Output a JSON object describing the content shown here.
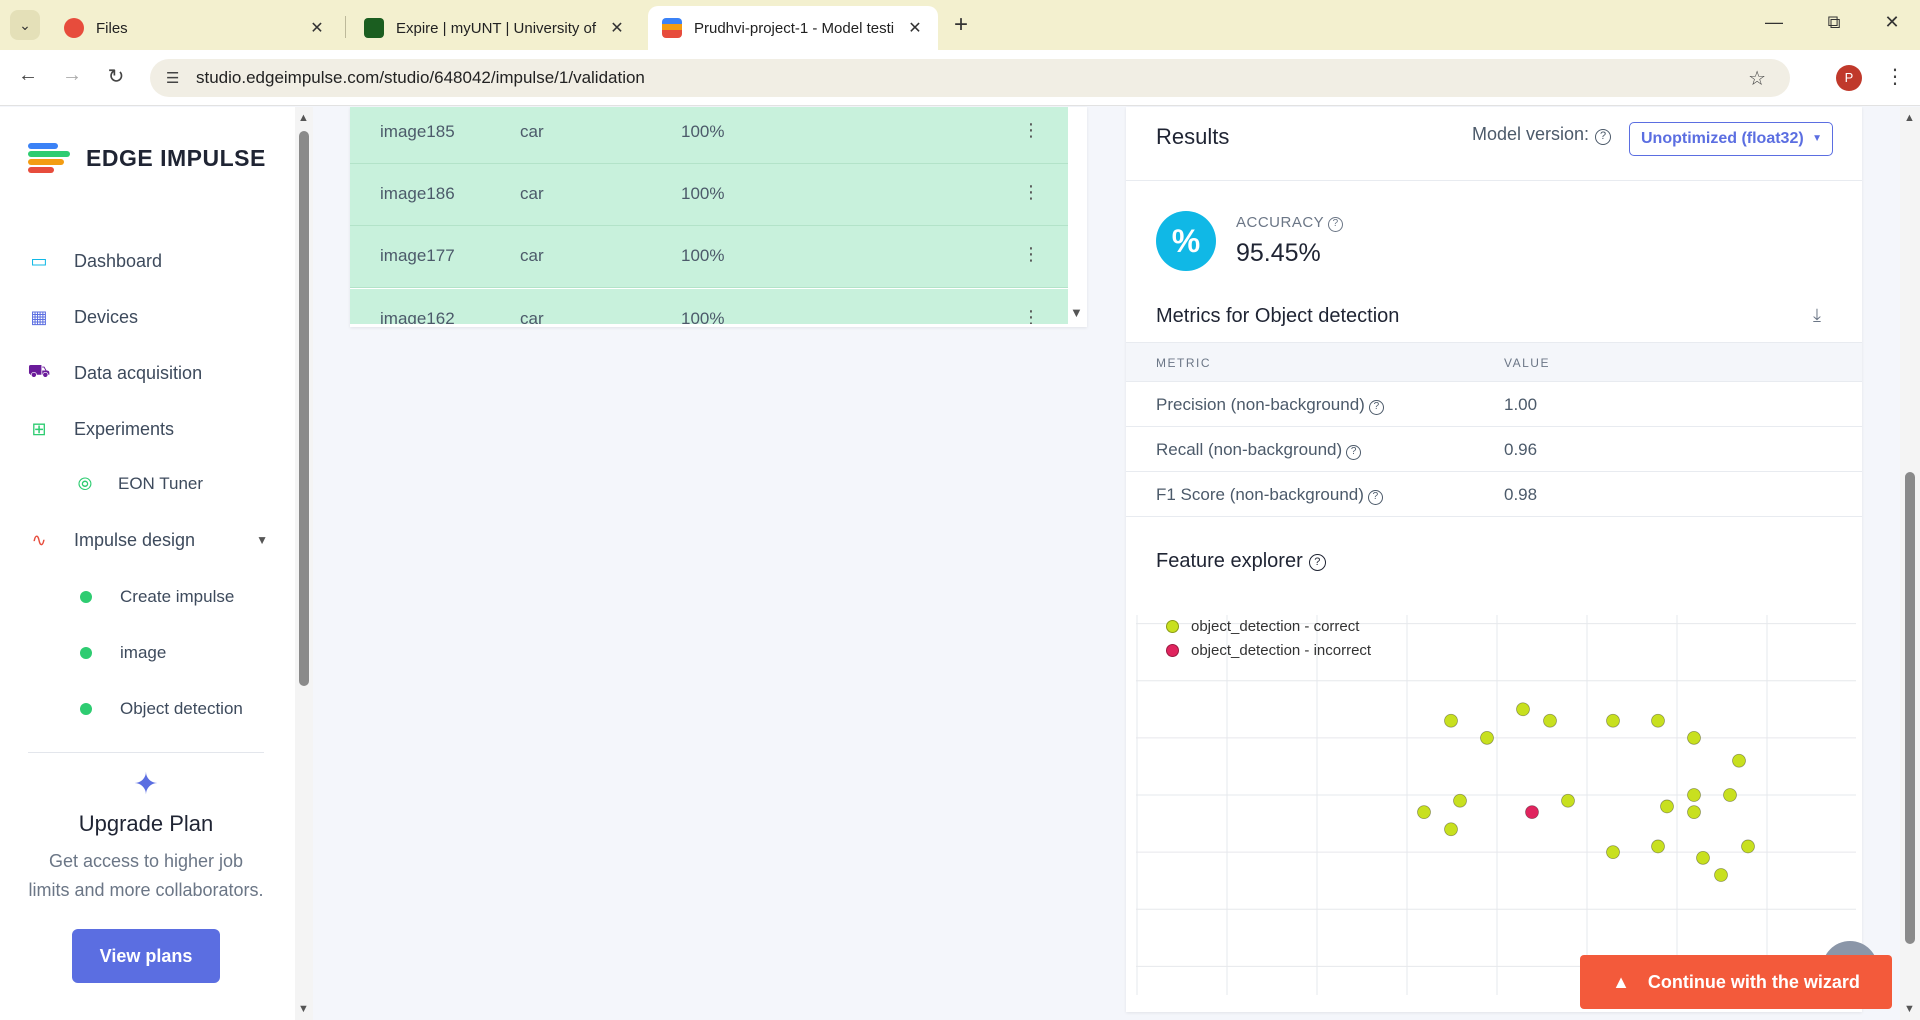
{
  "browser": {
    "tabs": [
      {
        "title": "Files",
        "favicon_color": "#e74c3c"
      },
      {
        "title": "Expire | myUNT | University of N",
        "favicon_color": "#1b5e20"
      },
      {
        "title": "Prudhvi-project-1 - Model testi",
        "favicon_color": "#f39c12"
      }
    ],
    "url": "studio.edgeimpulse.com/studio/648042/impulse/1/validation",
    "profile_initial": "P"
  },
  "sidebar": {
    "brand": "EDGE IMPULSE",
    "nav": [
      {
        "label": "Dashboard",
        "icon": "monitor-icon"
      },
      {
        "label": "Devices",
        "icon": "chip-icon"
      },
      {
        "label": "Data acquisition",
        "icon": "database-icon"
      },
      {
        "label": "Experiments",
        "icon": "table-icon"
      },
      {
        "label": "EON Tuner",
        "icon": "compass-icon"
      },
      {
        "label": "Impulse design",
        "icon": "pulse-icon"
      },
      {
        "label": "Create impulse"
      },
      {
        "label": "image"
      },
      {
        "label": "Object detection"
      }
    ],
    "upgrade": {
      "title": "Upgrade Plan",
      "text": "Get access to higher job limits and more collaborators.",
      "button": "View plans"
    }
  },
  "table": {
    "rows": [
      {
        "sample": "image185",
        "label": "car",
        "accuracy": "100%"
      },
      {
        "sample": "image186",
        "label": "car",
        "accuracy": "100%"
      },
      {
        "sample": "image177",
        "label": "car",
        "accuracy": "100%"
      },
      {
        "sample": "image162",
        "label": "car",
        "accuracy": "100%"
      }
    ]
  },
  "results": {
    "title": "Results",
    "model_version_label": "Model version:",
    "model_version_value": "Unoptimized (float32)",
    "accuracy_label": "ACCURACY",
    "accuracy_value": "95.45%",
    "metrics_title": "Metrics for Object detection",
    "metric_header": "METRIC",
    "value_header": "VALUE",
    "metrics": [
      {
        "name": "Precision (non-background)",
        "value": "1.00"
      },
      {
        "name": "Recall (non-background)",
        "value": "0.96"
      },
      {
        "name": "F1 Score (non-background)",
        "value": "0.98"
      }
    ],
    "feature_explorer_title": "Feature explorer",
    "legend": [
      {
        "label": "object_detection - correct",
        "color": "#c8e01f"
      },
      {
        "label": "object_detection - incorrect",
        "color": "#e0245e"
      }
    ]
  },
  "chart_data": {
    "type": "scatter",
    "x": [
      0,
      1,
      2,
      3,
      4,
      5,
      6,
      7,
      8
    ],
    "series": [
      {
        "name": "object_detection - correct",
        "color": "#c8e01f",
        "points": [
          [
            4.3,
            3.5
          ],
          [
            3.5,
            3.3
          ],
          [
            3.9,
            3.0
          ],
          [
            4.6,
            3.3
          ],
          [
            5.3,
            3.3
          ],
          [
            5.8,
            3.3
          ],
          [
            6.2,
            3.0
          ],
          [
            6.7,
            2.6
          ],
          [
            5.9,
            1.8
          ],
          [
            4.8,
            1.9
          ],
          [
            3.6,
            1.9
          ],
          [
            3.2,
            1.7
          ],
          [
            3.5,
            1.4
          ],
          [
            6.2,
            1.7
          ],
          [
            6.6,
            2.0
          ],
          [
            6.2,
            2.0
          ],
          [
            6.8,
            1.1
          ],
          [
            5.3,
            1.0
          ],
          [
            5.8,
            1.1
          ],
          [
            6.3,
            0.9
          ],
          [
            6.5,
            0.6
          ]
        ]
      },
      {
        "name": "object_detection - incorrect",
        "color": "#e0245e",
        "points": [
          [
            4.4,
            1.7
          ]
        ]
      }
    ],
    "xlim": [
      0,
      8
    ],
    "ylim": [
      -1.5,
      5.5
    ],
    "grid": true,
    "legend": "top-left"
  },
  "wizard_button": "Continue with the wizard"
}
